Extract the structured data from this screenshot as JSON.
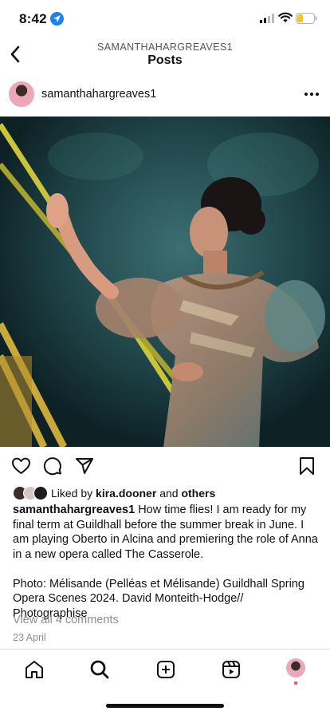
{
  "status_bar": {
    "time": "8:42",
    "icons": [
      "location-icon",
      "signal-icon",
      "wifi-icon",
      "battery-icon"
    ],
    "battery_color": "#f5c518"
  },
  "nav": {
    "subtitle": "SAMANTHAHARGREAVES1",
    "title": "Posts"
  },
  "post": {
    "username": "samanthahargreaves1",
    "photo_icon": "stage-photo",
    "likes": {
      "prefix": "Liked by",
      "user": "kira.dooner",
      "and": "and",
      "others": "others"
    },
    "caption": {
      "username": "samanthahargreaves1",
      "text": "How time flies! I am ready for my final term at Guildhall before the summer break in June. I am playing Oberto in Alcina and premiering the role of Anna in a new opera called The Casserole.",
      "credit": "Photo: Mélisande (Pelléas et Mélisande) Guildhall Spring Opera Scenes 2024. David Monteith-Hodge// Photographise"
    },
    "view_comments": "View all 4 comments",
    "date": "23 April"
  },
  "tabbar": {
    "items": [
      "home-icon",
      "search-icon",
      "create-icon",
      "reels-icon",
      "profile-avatar"
    ],
    "notification_color": "#ed4956"
  }
}
